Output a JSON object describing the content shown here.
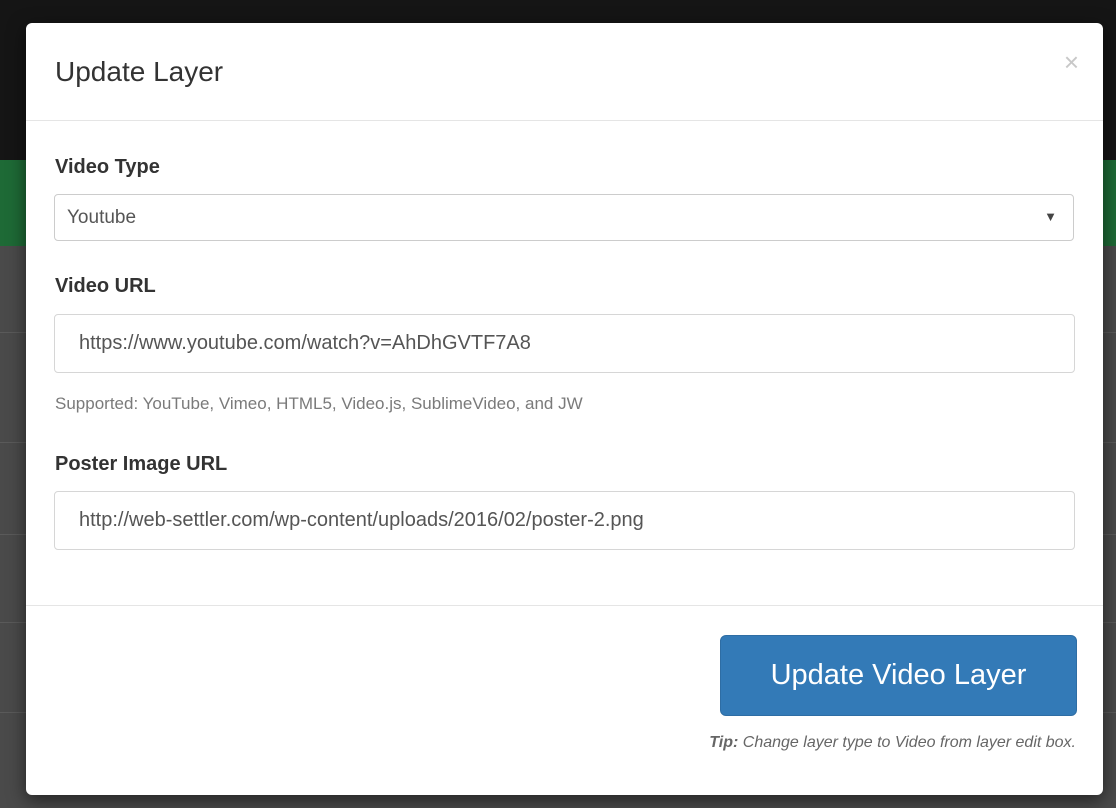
{
  "modal": {
    "title": "Update Layer",
    "close_glyph": "×"
  },
  "form": {
    "video_type": {
      "label": "Video Type",
      "selected": "Youtube"
    },
    "video_url": {
      "label": "Video URL",
      "value": "https://www.youtube.com/watch?v=AhDhGVTF7A8",
      "help": "Supported: YouTube, Vimeo, HTML5, Video.js, SublimeVideo, and JW"
    },
    "poster_url": {
      "label": "Poster Image URL",
      "value": "http://web-settler.com/wp-content/uploads/2016/02/poster-2.png"
    }
  },
  "footer": {
    "submit_label": "Update Video Layer",
    "tip_label": "Tip:",
    "tip_text": " Change layer type to Video from layer edit box."
  },
  "colors": {
    "primary": "#337ab7",
    "backdrop_green": "#1e6a36"
  },
  "icons": {
    "close": "close-icon",
    "caret": "caret-down-icon"
  }
}
